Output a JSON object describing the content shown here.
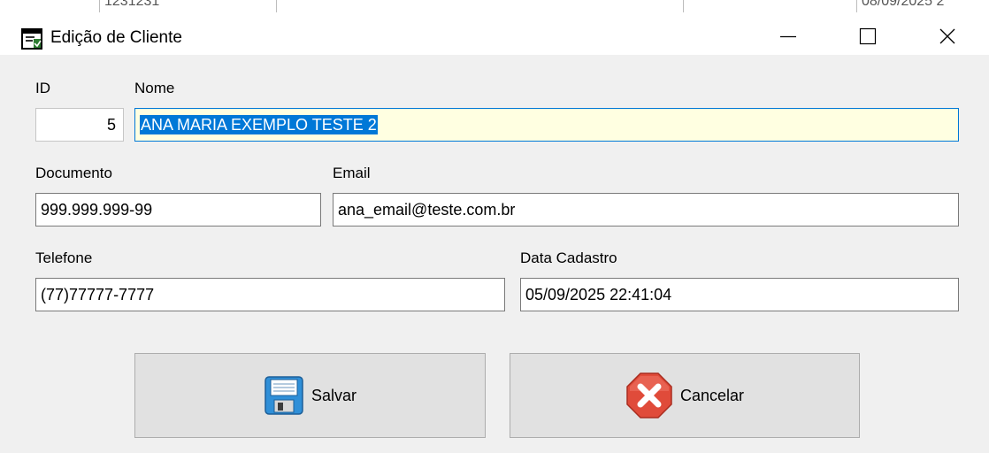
{
  "background_window": {
    "col_texts": [
      "1231231",
      "",
      "",
      "08/09/2025 2"
    ]
  },
  "window": {
    "title": "Edição de Cliente",
    "icon": "form-window-icon",
    "controls": [
      "minimize-icon",
      "maximize-icon",
      "close-icon"
    ]
  },
  "form": {
    "id": {
      "label": "ID",
      "value": "5"
    },
    "nome": {
      "label": "Nome",
      "value": "ANA MARIA EXEMPLO TESTE 2"
    },
    "documento": {
      "label": "Documento",
      "value": "999.999.999-99"
    },
    "email": {
      "label": "Email",
      "value": "ana_email@teste.com.br"
    },
    "telefone": {
      "label": "Telefone",
      "value": "(77)77777-7777"
    },
    "data_cadastro": {
      "label": "Data Cadastro",
      "value": "05/09/2025 22:41:04"
    }
  },
  "buttons": {
    "salvar": {
      "label": "Salvar",
      "icon": "floppy-disk-icon"
    },
    "cancelar": {
      "label": "Cancelar",
      "icon": "cancel-x-icon"
    }
  },
  "colors": {
    "selection": "#0078d7",
    "focused_field_bg": "#ffffe1",
    "cancel_red": "#e04b3a",
    "save_blue": "#2f8fd8"
  }
}
